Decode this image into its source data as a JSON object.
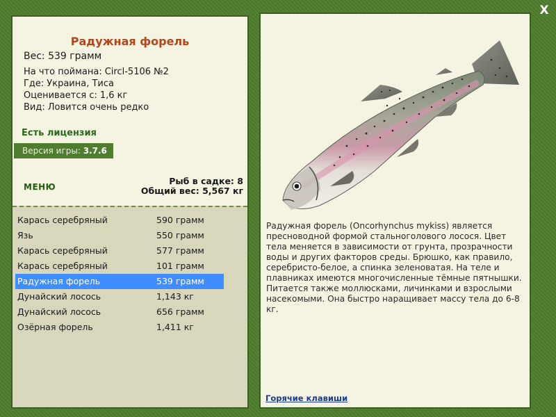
{
  "window": {
    "close_label": "X"
  },
  "catch": {
    "title": "Радужная форель",
    "weight_label": "Вес:",
    "weight_value": "539 грамм",
    "bait_label": "На что поймана:",
    "bait_value": "Circl-5106 №2",
    "location_label": "Где:",
    "location_value": "Украина, Тиса",
    "estimate_label": "Оценивается с:",
    "estimate_value": "1,6 кг",
    "rarity_label": "Вид:",
    "rarity_value": "Ловится очень редко"
  },
  "license": "Есть лицензия",
  "version": {
    "label": "Версия игры:",
    "value": "3.7.6"
  },
  "menu_label": "МЕНЮ",
  "cage": {
    "count_label": "Рыб в садке:",
    "count_value": "8",
    "weight_label": "Общий вес:",
    "weight_value": "5,567 кг"
  },
  "fish_list": [
    {
      "name": "Карась серебряный",
      "weight": "590 грамм",
      "selected": false
    },
    {
      "name": "Язь",
      "weight": "550 грамм",
      "selected": false
    },
    {
      "name": "Карась серебряный",
      "weight": "577 грамм",
      "selected": false
    },
    {
      "name": "Карась серебряный",
      "weight": "101 грамм",
      "selected": false
    },
    {
      "name": "Радужная форель",
      "weight": "539 грамм",
      "selected": true
    },
    {
      "name": "Дунайский лосось",
      "weight": "1,143 кг",
      "selected": false
    },
    {
      "name": "Дунайский лосось",
      "weight": "656 грамм",
      "selected": false
    },
    {
      "name": "Озёрная форель",
      "weight": "1,411 кг",
      "selected": false
    }
  ],
  "description": "Радужная форель (Oncorhynchus mykiss) является пресноводной формой стальноголового лосося. Цвет тела меняется в зависимости от грунта, прозрачности воды и других факторов среды. Брюшко, как правило, серебристо-белое, а спинка зеленоватая. На теле и плавниках имеются многочисленные тёмные пятнышки. Питается также моллюсками, личинками и взрослыми насекомыми. Она быстро наращивает массу тела до 6-8 кг.",
  "hotkeys_label": "Горячие клавиши",
  "colors": {
    "frame": "#4f7d2e",
    "panel": "#f5f4e3",
    "list_bg": "#d9d7bb",
    "title": "#b3461b",
    "license": "#2a6a1c",
    "selected": "#3f8dff",
    "link": "#1a3a9a"
  },
  "icons": {
    "close": "close-icon",
    "fish": "rainbow-trout-image"
  }
}
